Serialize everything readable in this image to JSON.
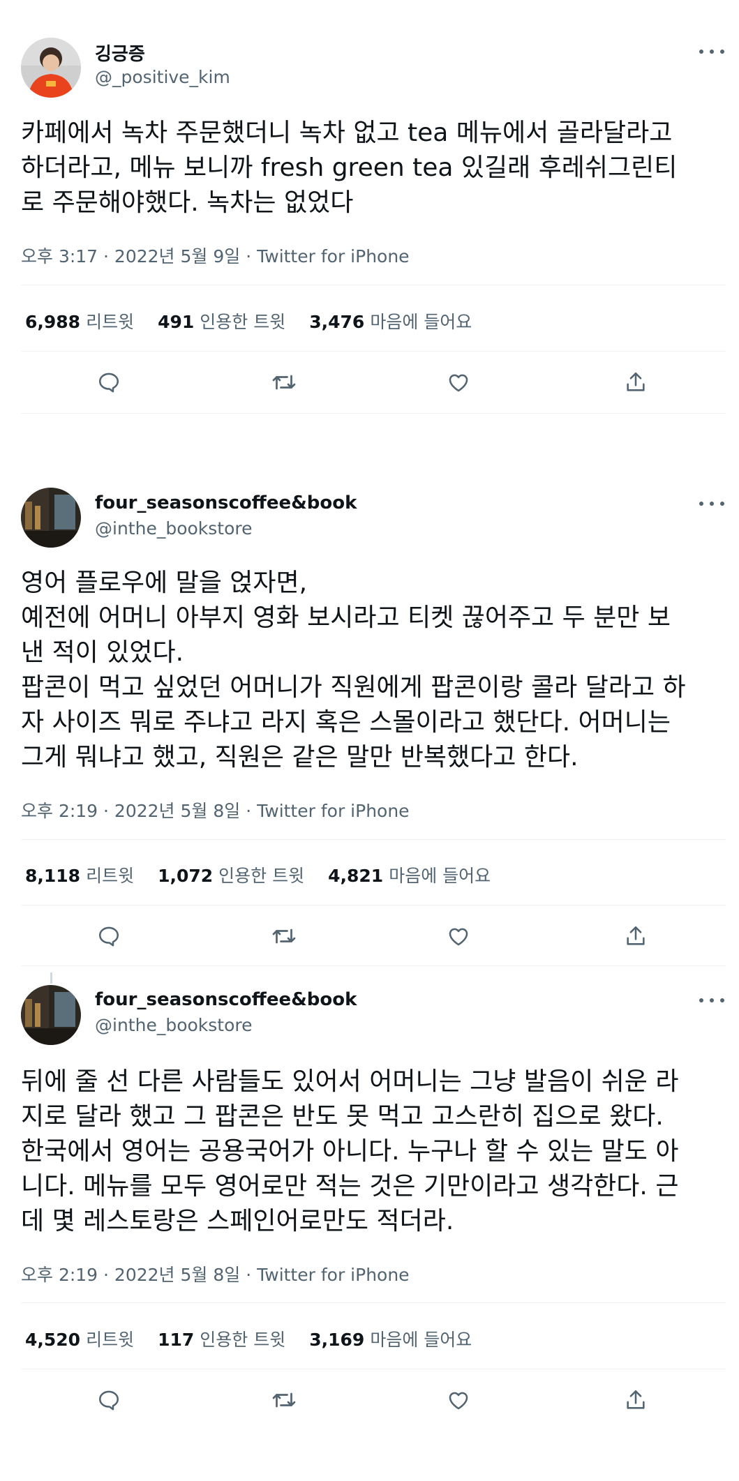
{
  "tweets": [
    {
      "name": "깅긍증",
      "handle": "@_positive_kim",
      "text": "카페에서 녹차 주문했더니 녹차 없고 tea 메뉴에서 골라달라고\n하더라고, 메뉴 보니까 fresh green tea 있길래 후레쉬그린티\n로 주문해야했다. 녹차는 없었다",
      "time": "오후 3:17 · 2022년 5월 9일 · ",
      "via": "Twitter for iPhone",
      "retweets": "6,988",
      "retweets_label": "리트윗",
      "quotes": "491",
      "quotes_label": "인용한 트윗",
      "likes": "3,476",
      "likes_label": "마음에 들어요"
    },
    {
      "name": "four_seasonscoffee&book",
      "handle": "@inthe_bookstore",
      "text": "영어 플로우에 말을 얹자면,\n예전에 어머니 아부지 영화 보시라고 티켓 끊어주고 두 분만 보\n낸 적이 있었다.\n팝콘이 먹고 싶었던 어머니가 직원에게 팝콘이랑 콜라 달라고 하\n자 사이즈 뭐로 주냐고 라지 혹은 스몰이라고 했단다. 어머니는\n그게 뭐냐고 했고, 직원은 같은 말만 반복했다고 한다.",
      "time": "오후 2:19 · 2022년 5월 8일 · ",
      "via": "Twitter for iPhone",
      "retweets": "8,118",
      "retweets_label": "리트윗",
      "quotes": "1,072",
      "quotes_label": "인용한 트윗",
      "likes": "4,821",
      "likes_label": "마음에 들어요"
    },
    {
      "name": "four_seasonscoffee&book",
      "handle": "@inthe_bookstore",
      "text": "뒤에 줄 선 다른 사람들도 있어서 어머니는 그냥 발음이 쉬운 라\n지로 달라 했고 그 팝콘은 반도 못 먹고 고스란히 집으로 왔다.\n한국에서 영어는 공용국어가 아니다. 누구나 할 수 있는 말도 아\n니다. 메뉴를 모두 영어로만 적는 것은 기만이라고 생각한다. 근\n데 몇 레스토랑은 스페인어로만도 적더라.",
      "time": "오후 2:19 · 2022년 5월 8일 · ",
      "via": "Twitter for iPhone",
      "retweets": "4,520",
      "retweets_label": "리트윗",
      "quotes": "117",
      "quotes_label": "인용한 트윗",
      "likes": "3,169",
      "likes_label": "마음에 들어요"
    }
  ],
  "icons": {
    "reply": "reply-icon",
    "retweet": "retweet-icon",
    "like": "heart-icon",
    "share": "share-icon",
    "more": "more-icon"
  },
  "colors": {
    "text": "#0f1419",
    "secondary": "#536471",
    "divider": "#eff3f4"
  }
}
